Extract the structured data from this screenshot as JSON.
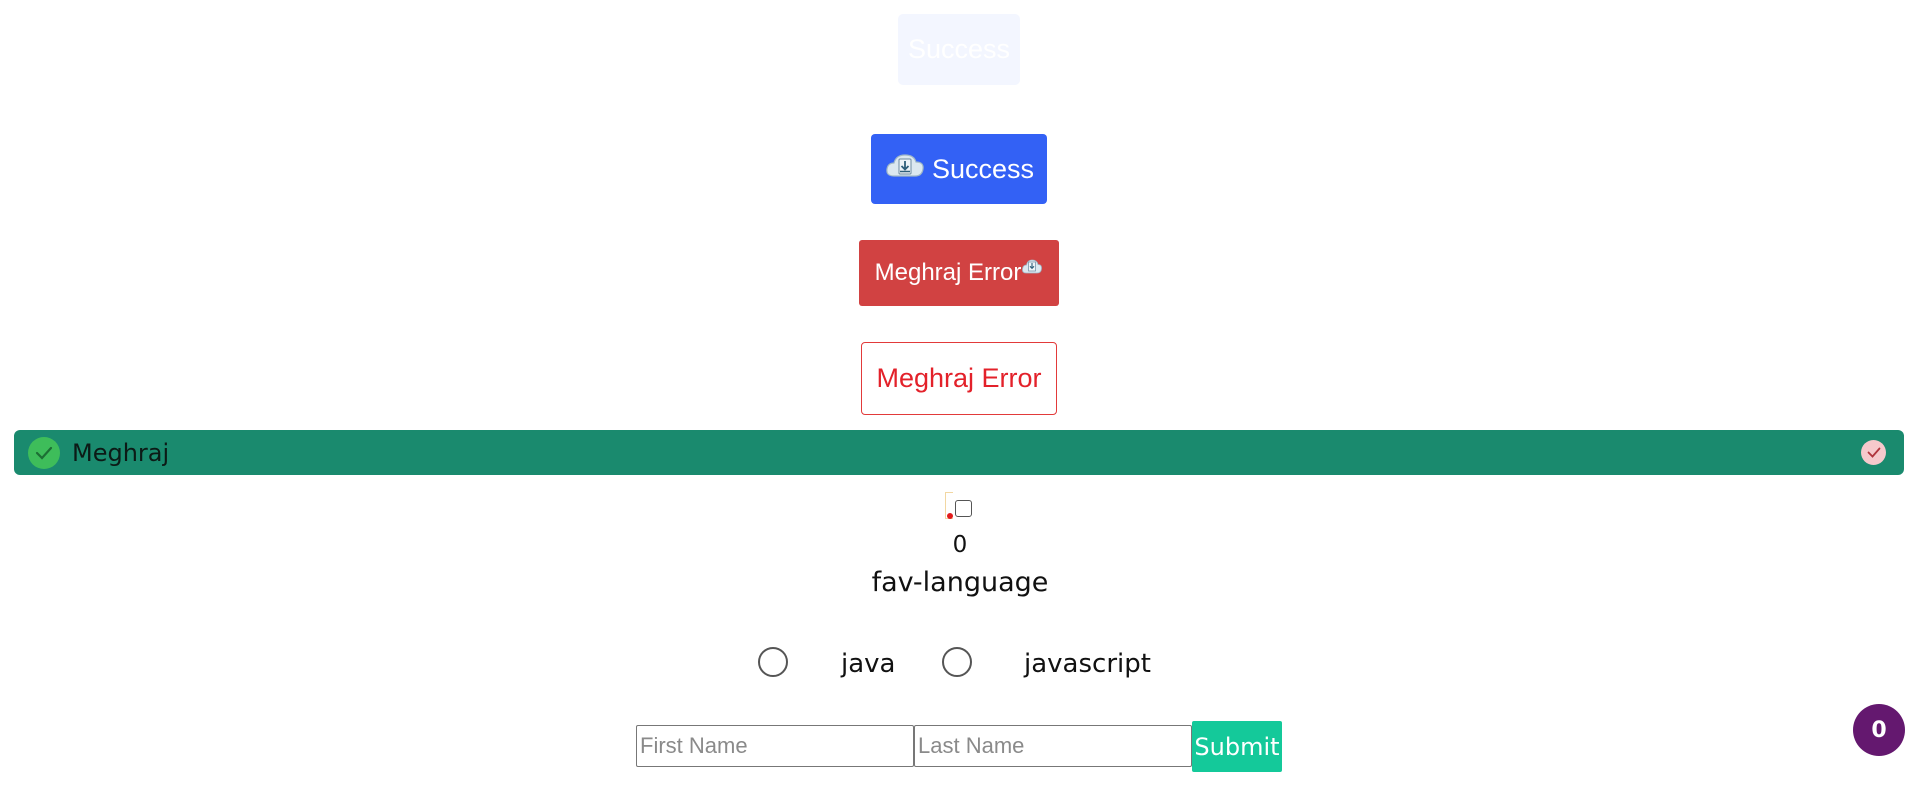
{
  "buttons": {
    "faded_success_label": "Success",
    "success_label": "Success",
    "error_label": "Meghraj Error",
    "error_outline_label": "Meghraj Error"
  },
  "banner": {
    "message": "Meghraj"
  },
  "counter": {
    "value": "0"
  },
  "radio_group": {
    "legend": "fav-language",
    "options": [
      "java",
      "javascript"
    ]
  },
  "form": {
    "first_name_placeholder": "First Name",
    "last_name_placeholder": "Last Name",
    "first_name_value": "",
    "last_name_value": "",
    "submit_label": "Submit"
  },
  "fab": {
    "count": "0"
  },
  "colors": {
    "primary": "#3361f5",
    "danger": "#d14242",
    "success_banner": "#1a8a6e",
    "submit": "#14c99a",
    "fab": "#64186f"
  },
  "icons": {
    "success_button_icon": "cloud-download-icon",
    "error_button_icon": "cloud-download-icon",
    "banner_icon": "check-circle-icon",
    "banner_close_icon": "check-icon"
  }
}
